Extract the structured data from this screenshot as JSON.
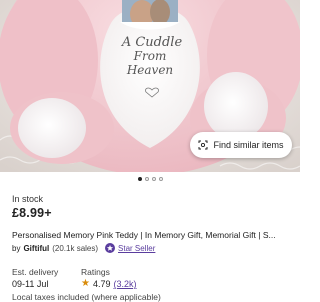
{
  "hero": {
    "photo_caption_lines": [
      "A Cuddle",
      "From",
      "Heaven"
    ],
    "find_similar_label": "Find similar items",
    "carousel_dot_count": 4,
    "carousel_active_index": 0
  },
  "listing": {
    "stock_status": "In stock",
    "price": "£8.99+",
    "title": "Personalised Memory Pink Teddy | In Memory Gift, Memorial Gift | S...",
    "by_label": "by",
    "shop_name": "Giftiful",
    "sales": "(20.1k sales)",
    "star_seller_label": "Star Seller"
  },
  "delivery": {
    "label": "Est. delivery",
    "value": "09-11 Jul"
  },
  "ratings": {
    "label": "Ratings",
    "score": "4.79",
    "count": "(3.2k)"
  },
  "taxes_note": "Local taxes included (where applicable)",
  "colors": {
    "accent_purple": "#5a3d9e",
    "star_gold": "#d98c0b",
    "bear_pink": "#f2c9cf"
  }
}
